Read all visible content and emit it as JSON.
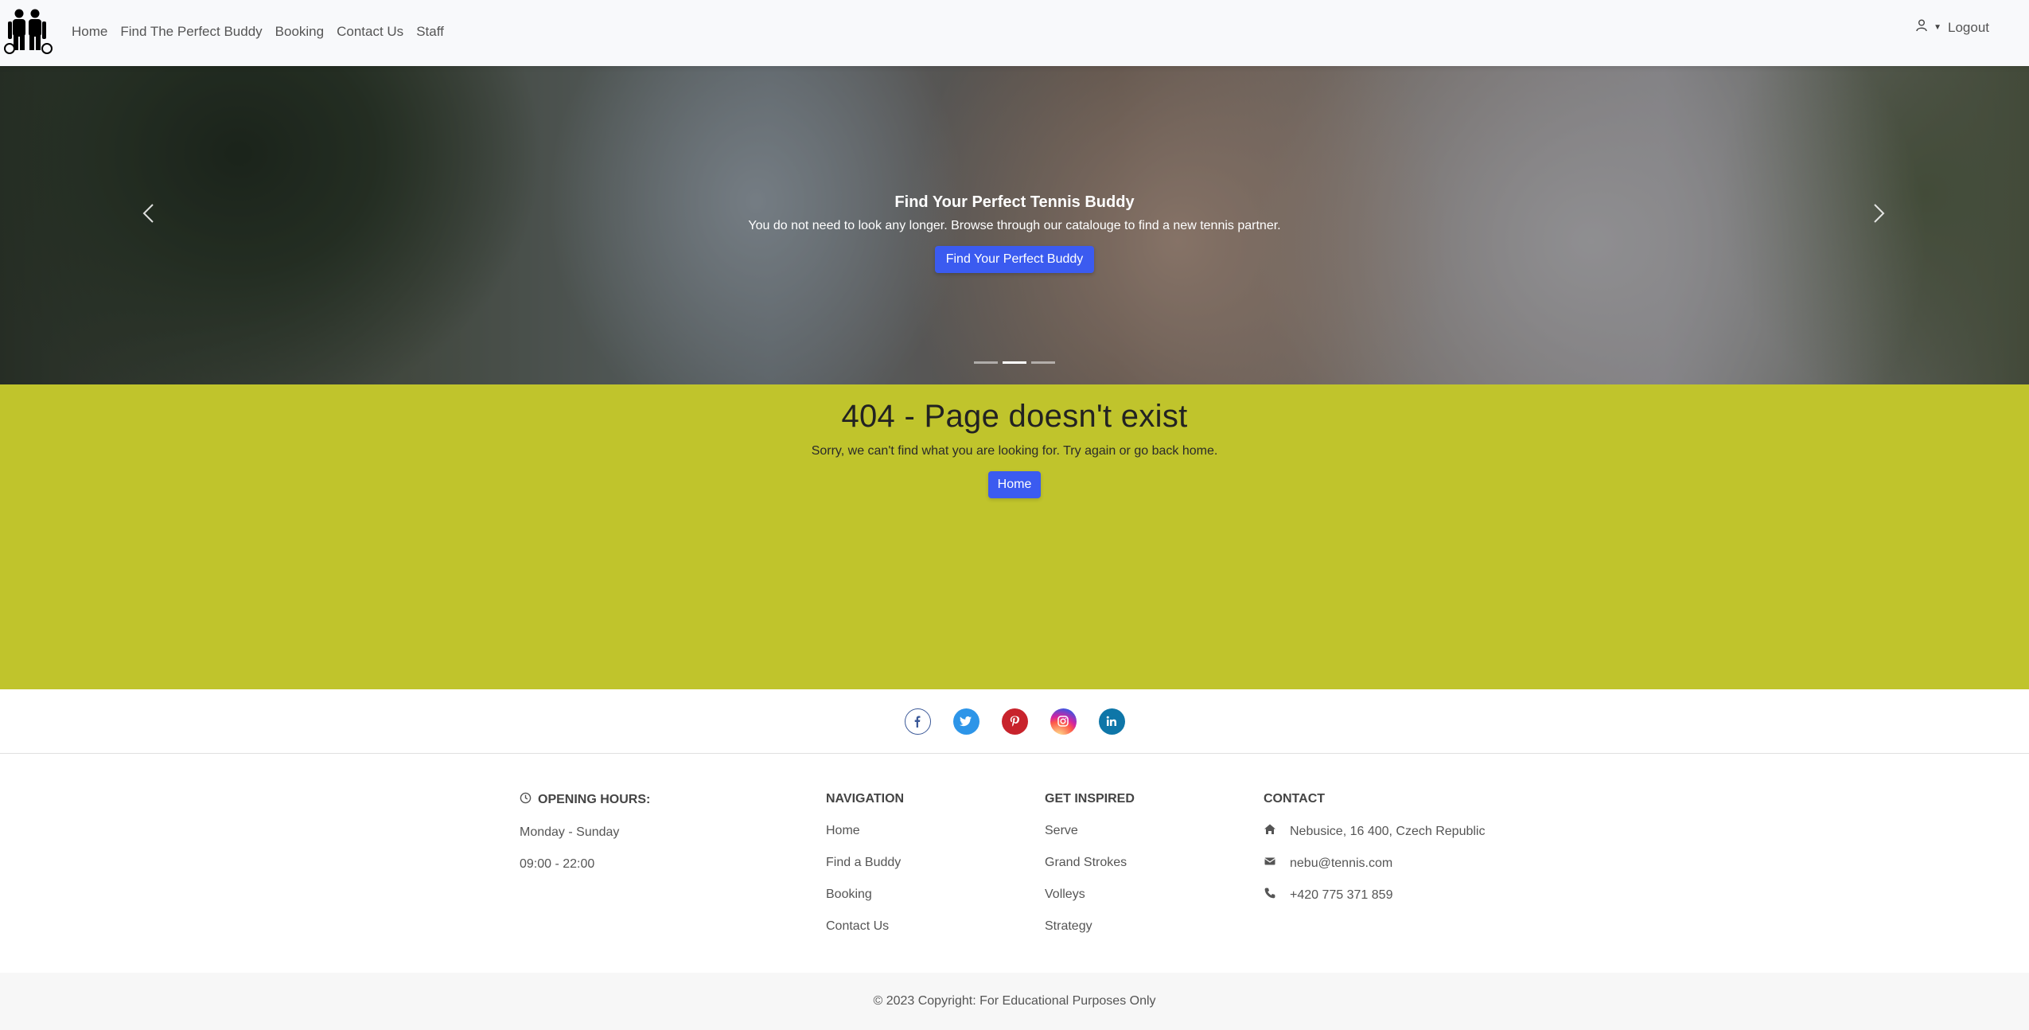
{
  "navbar": {
    "links": [
      "Home",
      "Find The Perfect Buddy",
      "Booking",
      "Contact Us",
      "Staff"
    ],
    "user_label": "Logout"
  },
  "hero": {
    "title": "Find Your Perfect Tennis Buddy",
    "text": "You do not need to look any longer. Browse through our catalouge to find a new tennis partner.",
    "button": "Find Your Perfect Buddy",
    "slides": 3,
    "active_slide": 2
  },
  "error": {
    "title": "404 - Page doesn't exist",
    "text": "Sorry, we can't find what you are looking for. Try again or go back home.",
    "button": "Home"
  },
  "social": [
    {
      "name": "facebook",
      "icon": "f",
      "color": "#ffffff",
      "fg": "#3b5998"
    },
    {
      "name": "twitter",
      "icon": "t",
      "color": "#2d95e8",
      "fg": "#ffffff"
    },
    {
      "name": "pinterest",
      "icon": "p",
      "color": "#c8232c",
      "fg": "#ffffff"
    },
    {
      "name": "instagram",
      "icon": "ig",
      "color": "#c13584",
      "fg": "#ffffff"
    },
    {
      "name": "linkedin",
      "icon": "in",
      "color": "#0e76a8",
      "fg": "#ffffff"
    }
  ],
  "footer": {
    "hours": {
      "title": "Opening hours:",
      "days": "Monday - Sunday",
      "time": "09:00 - 22:00"
    },
    "navigation": {
      "title": "Navigation",
      "items": [
        "Home",
        "Find a Buddy",
        "Booking",
        "Contact Us"
      ]
    },
    "inspired": {
      "title": "Get inspired",
      "items": [
        "Serve",
        "Grand Strokes",
        "Volleys",
        "Strategy"
      ]
    },
    "contact": {
      "title": "Contact",
      "address": "Nebusice, 16 400, Czech Republic",
      "email": "nebu@tennis.com",
      "phone": "+420 775 371 859"
    }
  },
  "copyright": "© 2023 Copyright: For Educational Purposes Only",
  "colors": {
    "accent": "#3b5bf0",
    "lime": "#c0c42c"
  }
}
